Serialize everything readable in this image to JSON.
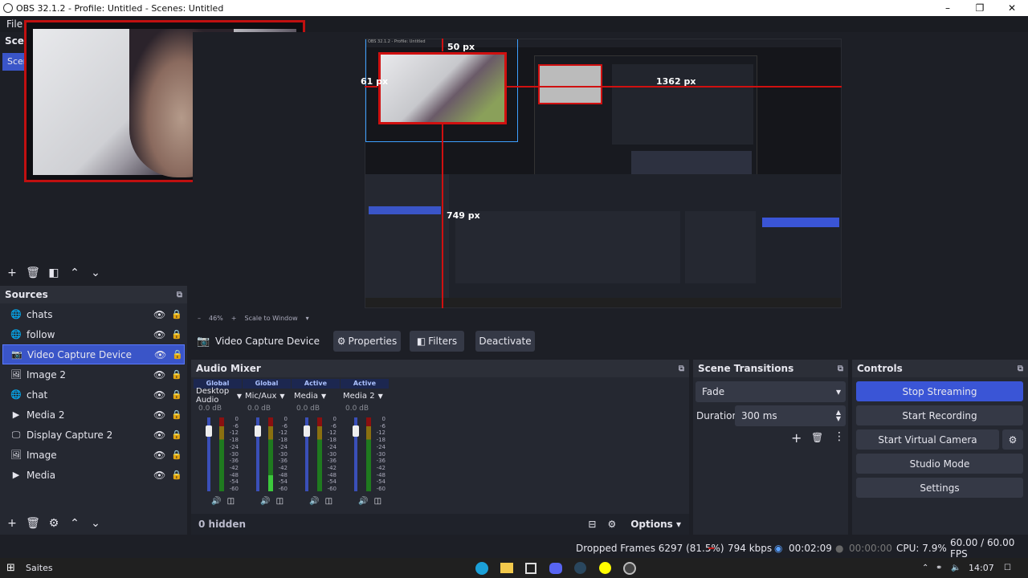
{
  "window": {
    "title": "OBS 32.1.2 - Profile: Untitled - Scenes: Untitled"
  },
  "menu": {
    "file": "File"
  },
  "scenes": {
    "header": "Scer",
    "active_item": "Scer"
  },
  "preview": {
    "labels": {
      "top": "50 px",
      "left": "61 px",
      "right": "1362 px",
      "bottom": "749 px"
    },
    "zoom": "46%",
    "scale_mode": "Scale to Window"
  },
  "sources": {
    "header": "Sources",
    "items": [
      {
        "label": "chats",
        "icon": "globe-icon"
      },
      {
        "label": "follow",
        "icon": "globe-icon"
      },
      {
        "label": "Video Capture Device",
        "icon": "camera-icon"
      },
      {
        "label": "Image 2",
        "icon": "image-icon"
      },
      {
        "label": "chat",
        "icon": "globe-icon"
      },
      {
        "label": "Media 2",
        "icon": "play-icon"
      },
      {
        "label": "Display Capture 2",
        "icon": "monitor-icon"
      },
      {
        "label": "Image",
        "icon": "image-icon"
      },
      {
        "label": "Media",
        "icon": "play-icon"
      }
    ],
    "selected_index": 2
  },
  "selected_bar": {
    "name": "Video Capture Device",
    "properties": "Properties",
    "filters": "Filters",
    "deactivate": "Deactivate"
  },
  "mixer": {
    "header": "Audio Mixer",
    "channels": [
      {
        "tag": "Global",
        "name": "Desktop Audio",
        "db": "0.0 dB",
        "fader_level": 0.85,
        "meter_level": 0.0
      },
      {
        "tag": "Global",
        "name": "Mic/Aux",
        "db": "0.0 dB",
        "fader_level": 0.85,
        "meter_level": 0.22
      },
      {
        "tag": "Active",
        "name": "Media",
        "db": "0.0 dB",
        "fader_level": 0.85,
        "meter_level": 0.0
      },
      {
        "tag": "Active",
        "name": "Media 2",
        "db": "0.0 dB",
        "fader_level": 0.85,
        "meter_level": 0.0
      }
    ],
    "scale": [
      "0",
      "-6",
      "-12",
      "-18",
      "-24",
      "-30",
      "-36",
      "-42",
      "-48",
      "-54",
      "-60"
    ],
    "hidden": "0 hidden",
    "options": "Options"
  },
  "transitions": {
    "header": "Scene Transitions",
    "selected": "Fade",
    "duration_label": "Duration",
    "duration_value": "300 ms"
  },
  "controls": {
    "header": "Controls",
    "stop_streaming": "Stop Streaming",
    "start_recording": "Start Recording",
    "start_virtual_camera": "Start Virtual Camera",
    "studio_mode": "Studio Mode",
    "settings": "Settings"
  },
  "status": {
    "dropped": "Dropped Frames 6297 (81.5%)",
    "kbps": "794 kbps",
    "stream_time": "00:02:09",
    "rec_time": "00:00:00",
    "cpu": "CPU: 7.9%",
    "fps": "60.00 / 60.00 FPS"
  },
  "taskbar": {
    "weather": "Saites",
    "time": "14:07"
  },
  "colors": {
    "accent": "#3a55d6",
    "red": "#d01010",
    "meter_green": "#3cc83c"
  }
}
